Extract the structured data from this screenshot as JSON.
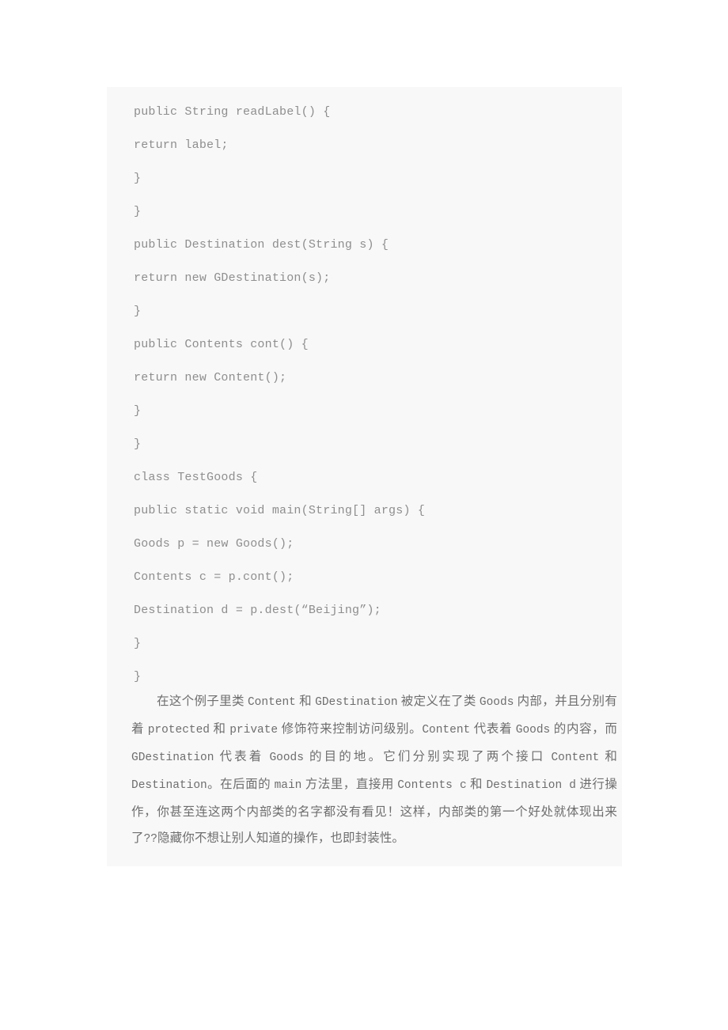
{
  "page": {
    "background_color": "#ffffff",
    "content_block_color": "#f8f8f8",
    "code_text_color": "#8e8e8e",
    "prose_text_color": "#6e6e6e"
  },
  "code_listing": {
    "language": "java",
    "lines": [
      "public String readLabel() {",
      "return label;",
      "}",
      "}",
      "public Destination dest(String s) {",
      "return new GDestination(s);",
      "}",
      "public Contents cont() {",
      "return new Content();",
      "}",
      "}",
      "class TestGoods {",
      "public static void main(String[] args) {",
      "Goods p = new Goods();",
      "Contents c = p.cont();",
      "Destination d = p.dest(“Beijing”);",
      "}",
      "}"
    ]
  },
  "prose": {
    "paragraph": "在这个例子里类 Content 和 GDestination 被定义在了类 Goods 内部，并且分别有着 protected 和 private 修饰符来控制访问级别。Content 代表着 Goods 的内容，而 GDestination 代表着 Goods 的目的地。它们分别实现了两个接口 Content 和 Destination。在后面的 main 方法里，直接用 Contents c 和 Destination d 进行操作，你甚至连这两个内部类的名字都没有看见！这样，内部类的第一个好处就体现出来了??隐藏你不想让别人知道的操作，也即封装性。"
  }
}
